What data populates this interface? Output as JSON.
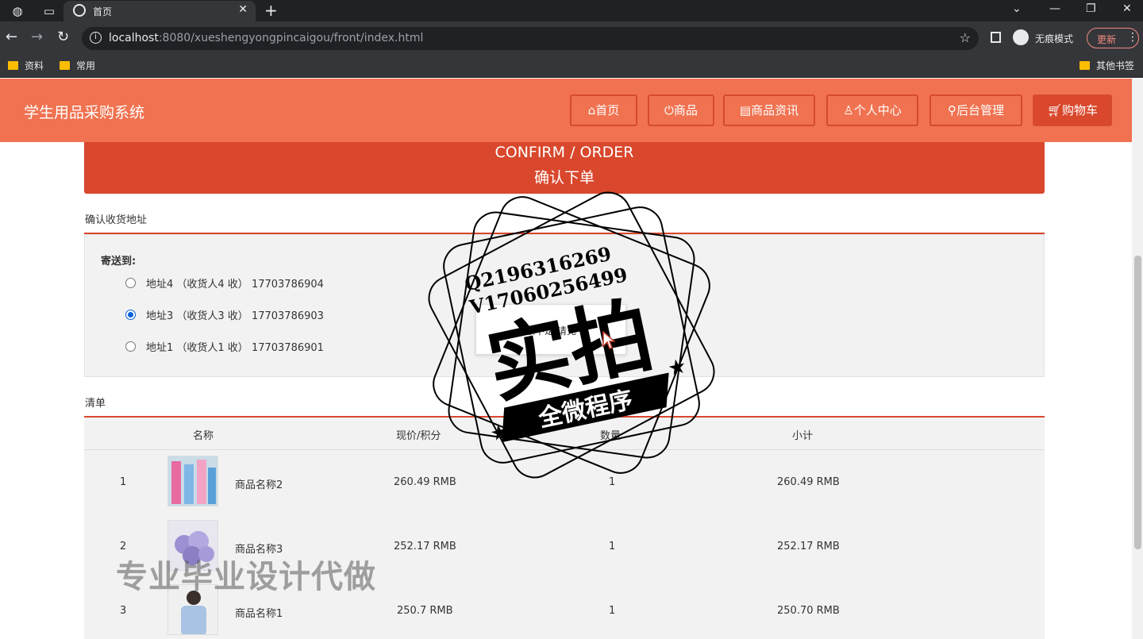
{
  "browser": {
    "tab_title": "首页",
    "url_host": "localhost",
    "url_rest": ":8080/xueshengyongpincaigou/front/index.html",
    "incognito_label": "无痕模式",
    "update_label": "更新",
    "bookmarks": [
      "资料",
      "常用"
    ],
    "other_bookmarks": "其他书签"
  },
  "site": {
    "title": "学生用品采购系统",
    "nav": [
      "首页",
      "商品",
      "商品资讯",
      "个人中心",
      "后台管理",
      "购物车"
    ],
    "nav_icons": [
      "home-icon",
      "power-icon",
      "news-icon",
      "user-icon",
      "link-icon",
      "cart-icon"
    ],
    "accent": "#f07250",
    "accent_dark": "#d9472c"
  },
  "banner": {
    "en": "CONFIRM / ORDER",
    "cn": "确认下单"
  },
  "address": {
    "section_title": "确认收货地址",
    "ship_to": "寄送到:",
    "options": [
      {
        "text": "地址4 （收货人4 收） 17703786904",
        "checked": false
      },
      {
        "text": "地址3 （收货人3 收） 17703786903",
        "checked": true
      },
      {
        "text": "地址1 （收货人1 收） 17703786901",
        "checked": false
      }
    ]
  },
  "list": {
    "section_title": "清单",
    "headers": [
      "名称",
      "现价/积分",
      "数量",
      "小计"
    ],
    "rows": [
      {
        "no": "1",
        "name": "商品名称2",
        "price": "260.49 RMB",
        "qty": "1",
        "subtotal": "260.49 RMB"
      },
      {
        "no": "2",
        "name": "商品名称3",
        "price": "252.17 RMB",
        "qty": "1",
        "subtotal": "252.17 RMB"
      },
      {
        "no": "3",
        "name": "商品名称1",
        "price": "250.7 RMB",
        "qty": "1",
        "subtotal": "250.70 RMB"
      }
    ]
  },
  "popup": {
    "message": "额不足,请充"
  },
  "stamp": {
    "line1": "Q2196316269",
    "line2": "V17060256499",
    "big": "实拍",
    "ribbon": "全微程序"
  },
  "watermark": "专业毕业设计代做"
}
